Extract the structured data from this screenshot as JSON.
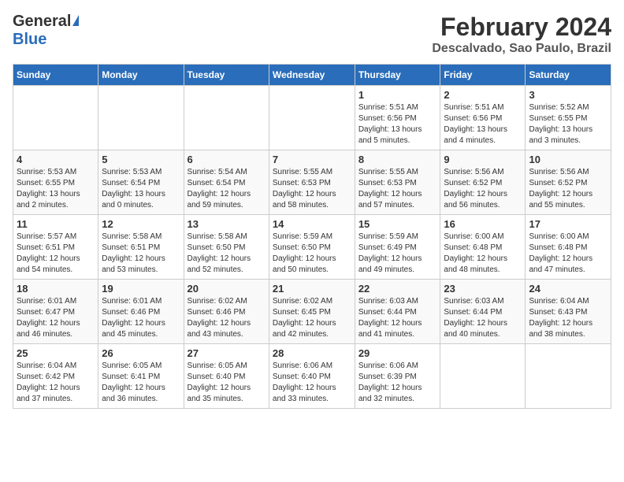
{
  "header": {
    "logo_general": "General",
    "logo_blue": "Blue",
    "month_title": "February 2024",
    "location": "Descalvado, Sao Paulo, Brazil"
  },
  "days_of_week": [
    "Sunday",
    "Monday",
    "Tuesday",
    "Wednesday",
    "Thursday",
    "Friday",
    "Saturday"
  ],
  "weeks": [
    {
      "days": [
        {
          "num": "",
          "info": ""
        },
        {
          "num": "",
          "info": ""
        },
        {
          "num": "",
          "info": ""
        },
        {
          "num": "",
          "info": ""
        },
        {
          "num": "1",
          "info": "Sunrise: 5:51 AM\nSunset: 6:56 PM\nDaylight: 13 hours\nand 5 minutes."
        },
        {
          "num": "2",
          "info": "Sunrise: 5:51 AM\nSunset: 6:56 PM\nDaylight: 13 hours\nand 4 minutes."
        },
        {
          "num": "3",
          "info": "Sunrise: 5:52 AM\nSunset: 6:55 PM\nDaylight: 13 hours\nand 3 minutes."
        }
      ]
    },
    {
      "days": [
        {
          "num": "4",
          "info": "Sunrise: 5:53 AM\nSunset: 6:55 PM\nDaylight: 13 hours\nand 2 minutes."
        },
        {
          "num": "5",
          "info": "Sunrise: 5:53 AM\nSunset: 6:54 PM\nDaylight: 13 hours\nand 0 minutes."
        },
        {
          "num": "6",
          "info": "Sunrise: 5:54 AM\nSunset: 6:54 PM\nDaylight: 12 hours\nand 59 minutes."
        },
        {
          "num": "7",
          "info": "Sunrise: 5:55 AM\nSunset: 6:53 PM\nDaylight: 12 hours\nand 58 minutes."
        },
        {
          "num": "8",
          "info": "Sunrise: 5:55 AM\nSunset: 6:53 PM\nDaylight: 12 hours\nand 57 minutes."
        },
        {
          "num": "9",
          "info": "Sunrise: 5:56 AM\nSunset: 6:52 PM\nDaylight: 12 hours\nand 56 minutes."
        },
        {
          "num": "10",
          "info": "Sunrise: 5:56 AM\nSunset: 6:52 PM\nDaylight: 12 hours\nand 55 minutes."
        }
      ]
    },
    {
      "days": [
        {
          "num": "11",
          "info": "Sunrise: 5:57 AM\nSunset: 6:51 PM\nDaylight: 12 hours\nand 54 minutes."
        },
        {
          "num": "12",
          "info": "Sunrise: 5:58 AM\nSunset: 6:51 PM\nDaylight: 12 hours\nand 53 minutes."
        },
        {
          "num": "13",
          "info": "Sunrise: 5:58 AM\nSunset: 6:50 PM\nDaylight: 12 hours\nand 52 minutes."
        },
        {
          "num": "14",
          "info": "Sunrise: 5:59 AM\nSunset: 6:50 PM\nDaylight: 12 hours\nand 50 minutes."
        },
        {
          "num": "15",
          "info": "Sunrise: 5:59 AM\nSunset: 6:49 PM\nDaylight: 12 hours\nand 49 minutes."
        },
        {
          "num": "16",
          "info": "Sunrise: 6:00 AM\nSunset: 6:48 PM\nDaylight: 12 hours\nand 48 minutes."
        },
        {
          "num": "17",
          "info": "Sunrise: 6:00 AM\nSunset: 6:48 PM\nDaylight: 12 hours\nand 47 minutes."
        }
      ]
    },
    {
      "days": [
        {
          "num": "18",
          "info": "Sunrise: 6:01 AM\nSunset: 6:47 PM\nDaylight: 12 hours\nand 46 minutes."
        },
        {
          "num": "19",
          "info": "Sunrise: 6:01 AM\nSunset: 6:46 PM\nDaylight: 12 hours\nand 45 minutes."
        },
        {
          "num": "20",
          "info": "Sunrise: 6:02 AM\nSunset: 6:46 PM\nDaylight: 12 hours\nand 43 minutes."
        },
        {
          "num": "21",
          "info": "Sunrise: 6:02 AM\nSunset: 6:45 PM\nDaylight: 12 hours\nand 42 minutes."
        },
        {
          "num": "22",
          "info": "Sunrise: 6:03 AM\nSunset: 6:44 PM\nDaylight: 12 hours\nand 41 minutes."
        },
        {
          "num": "23",
          "info": "Sunrise: 6:03 AM\nSunset: 6:44 PM\nDaylight: 12 hours\nand 40 minutes."
        },
        {
          "num": "24",
          "info": "Sunrise: 6:04 AM\nSunset: 6:43 PM\nDaylight: 12 hours\nand 38 minutes."
        }
      ]
    },
    {
      "days": [
        {
          "num": "25",
          "info": "Sunrise: 6:04 AM\nSunset: 6:42 PM\nDaylight: 12 hours\nand 37 minutes."
        },
        {
          "num": "26",
          "info": "Sunrise: 6:05 AM\nSunset: 6:41 PM\nDaylight: 12 hours\nand 36 minutes."
        },
        {
          "num": "27",
          "info": "Sunrise: 6:05 AM\nSunset: 6:40 PM\nDaylight: 12 hours\nand 35 minutes."
        },
        {
          "num": "28",
          "info": "Sunrise: 6:06 AM\nSunset: 6:40 PM\nDaylight: 12 hours\nand 33 minutes."
        },
        {
          "num": "29",
          "info": "Sunrise: 6:06 AM\nSunset: 6:39 PM\nDaylight: 12 hours\nand 32 minutes."
        },
        {
          "num": "",
          "info": ""
        },
        {
          "num": "",
          "info": ""
        }
      ]
    }
  ]
}
